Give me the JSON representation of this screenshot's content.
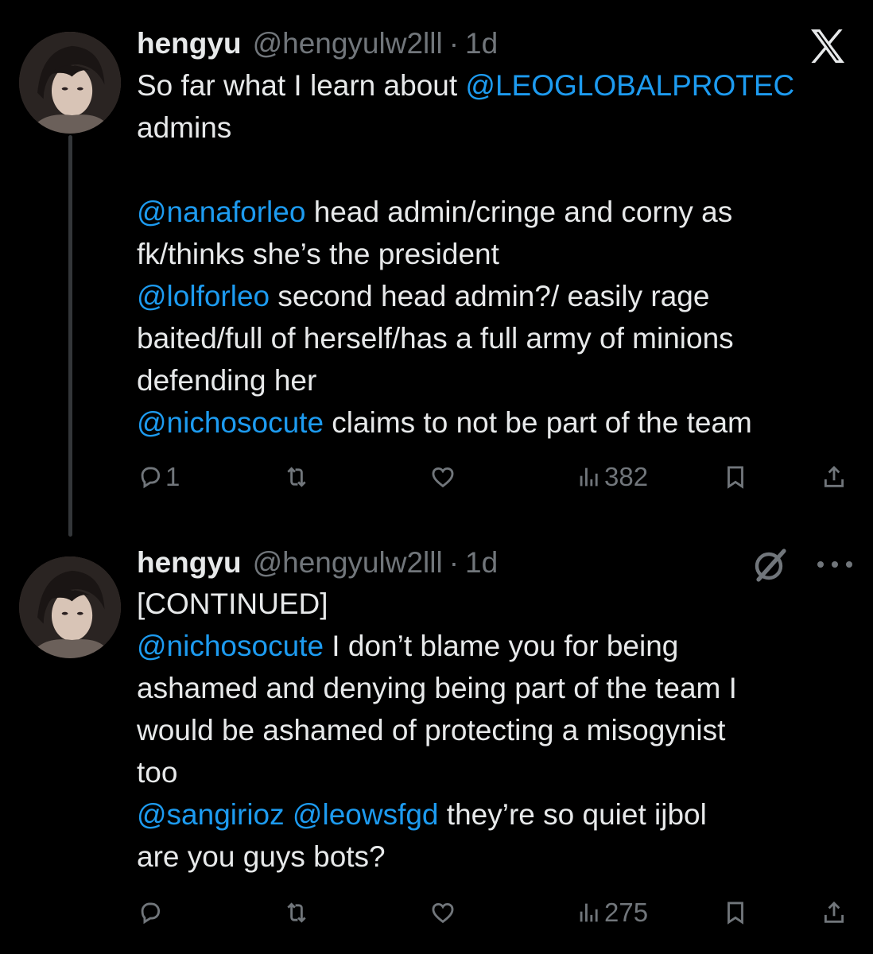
{
  "tweets": [
    {
      "author": {
        "name": "hengyu",
        "handle": "@hengyulw2lll",
        "separator": "·",
        "time": "1d",
        "avatar_icon": "profile-photo"
      },
      "body": [
        {
          "type": "text",
          "value": "So far what I learn about "
        },
        {
          "type": "mention",
          "value": "@LEOGLOBALPROTEC"
        },
        {
          "type": "text",
          "value": "\nadmins\n\n"
        },
        {
          "type": "mention",
          "value": "@nanaforleo"
        },
        {
          "type": "text",
          "value": " head admin/cringe and corny as\nfk/thinks she’s the president\n"
        },
        {
          "type": "mention",
          "value": "@lolforleo"
        },
        {
          "type": "text",
          "value": " second head admin?/ easily rage\nbaited/full of herself/has a full army of minions\ndefending her\n"
        },
        {
          "type": "mention",
          "value": "@nichosocute"
        },
        {
          "type": "text",
          "value": " claims to not be part of the team"
        }
      ],
      "actions": {
        "reply_count": "1",
        "retweet_count": "",
        "like_count": "",
        "views_count": "382"
      }
    },
    {
      "author": {
        "name": "hengyu",
        "handle": "@hengyulw2lll",
        "separator": "·",
        "time": "1d",
        "avatar_icon": "profile-photo"
      },
      "body": [
        {
          "type": "text",
          "value": "[CONTINUED]\n"
        },
        {
          "type": "mention",
          "value": "@nichosocute"
        },
        {
          "type": "text",
          "value": " I don’t blame you for being\nashamed and denying being part of the team I\nwould be ashamed of protecting a misogynist\ntoo\n"
        },
        {
          "type": "mention",
          "value": "@sangirioz"
        },
        {
          "type": "text",
          "value": " "
        },
        {
          "type": "mention",
          "value": "@leowsfgd"
        },
        {
          "type": "text",
          "value": " they’re so quiet ijbol\nare you guys bots?"
        }
      ],
      "actions": {
        "reply_count": "",
        "retweet_count": "",
        "like_count": "",
        "views_count": "275"
      }
    }
  ],
  "icons": {
    "top_right": "x-logo-icon",
    "second_tweet_right": [
      "grok-icon",
      "more-icon"
    ]
  },
  "colors": {
    "background": "#000000",
    "text": "#e7e9ea",
    "muted": "#71767b",
    "mention": "#1d9bf0"
  }
}
